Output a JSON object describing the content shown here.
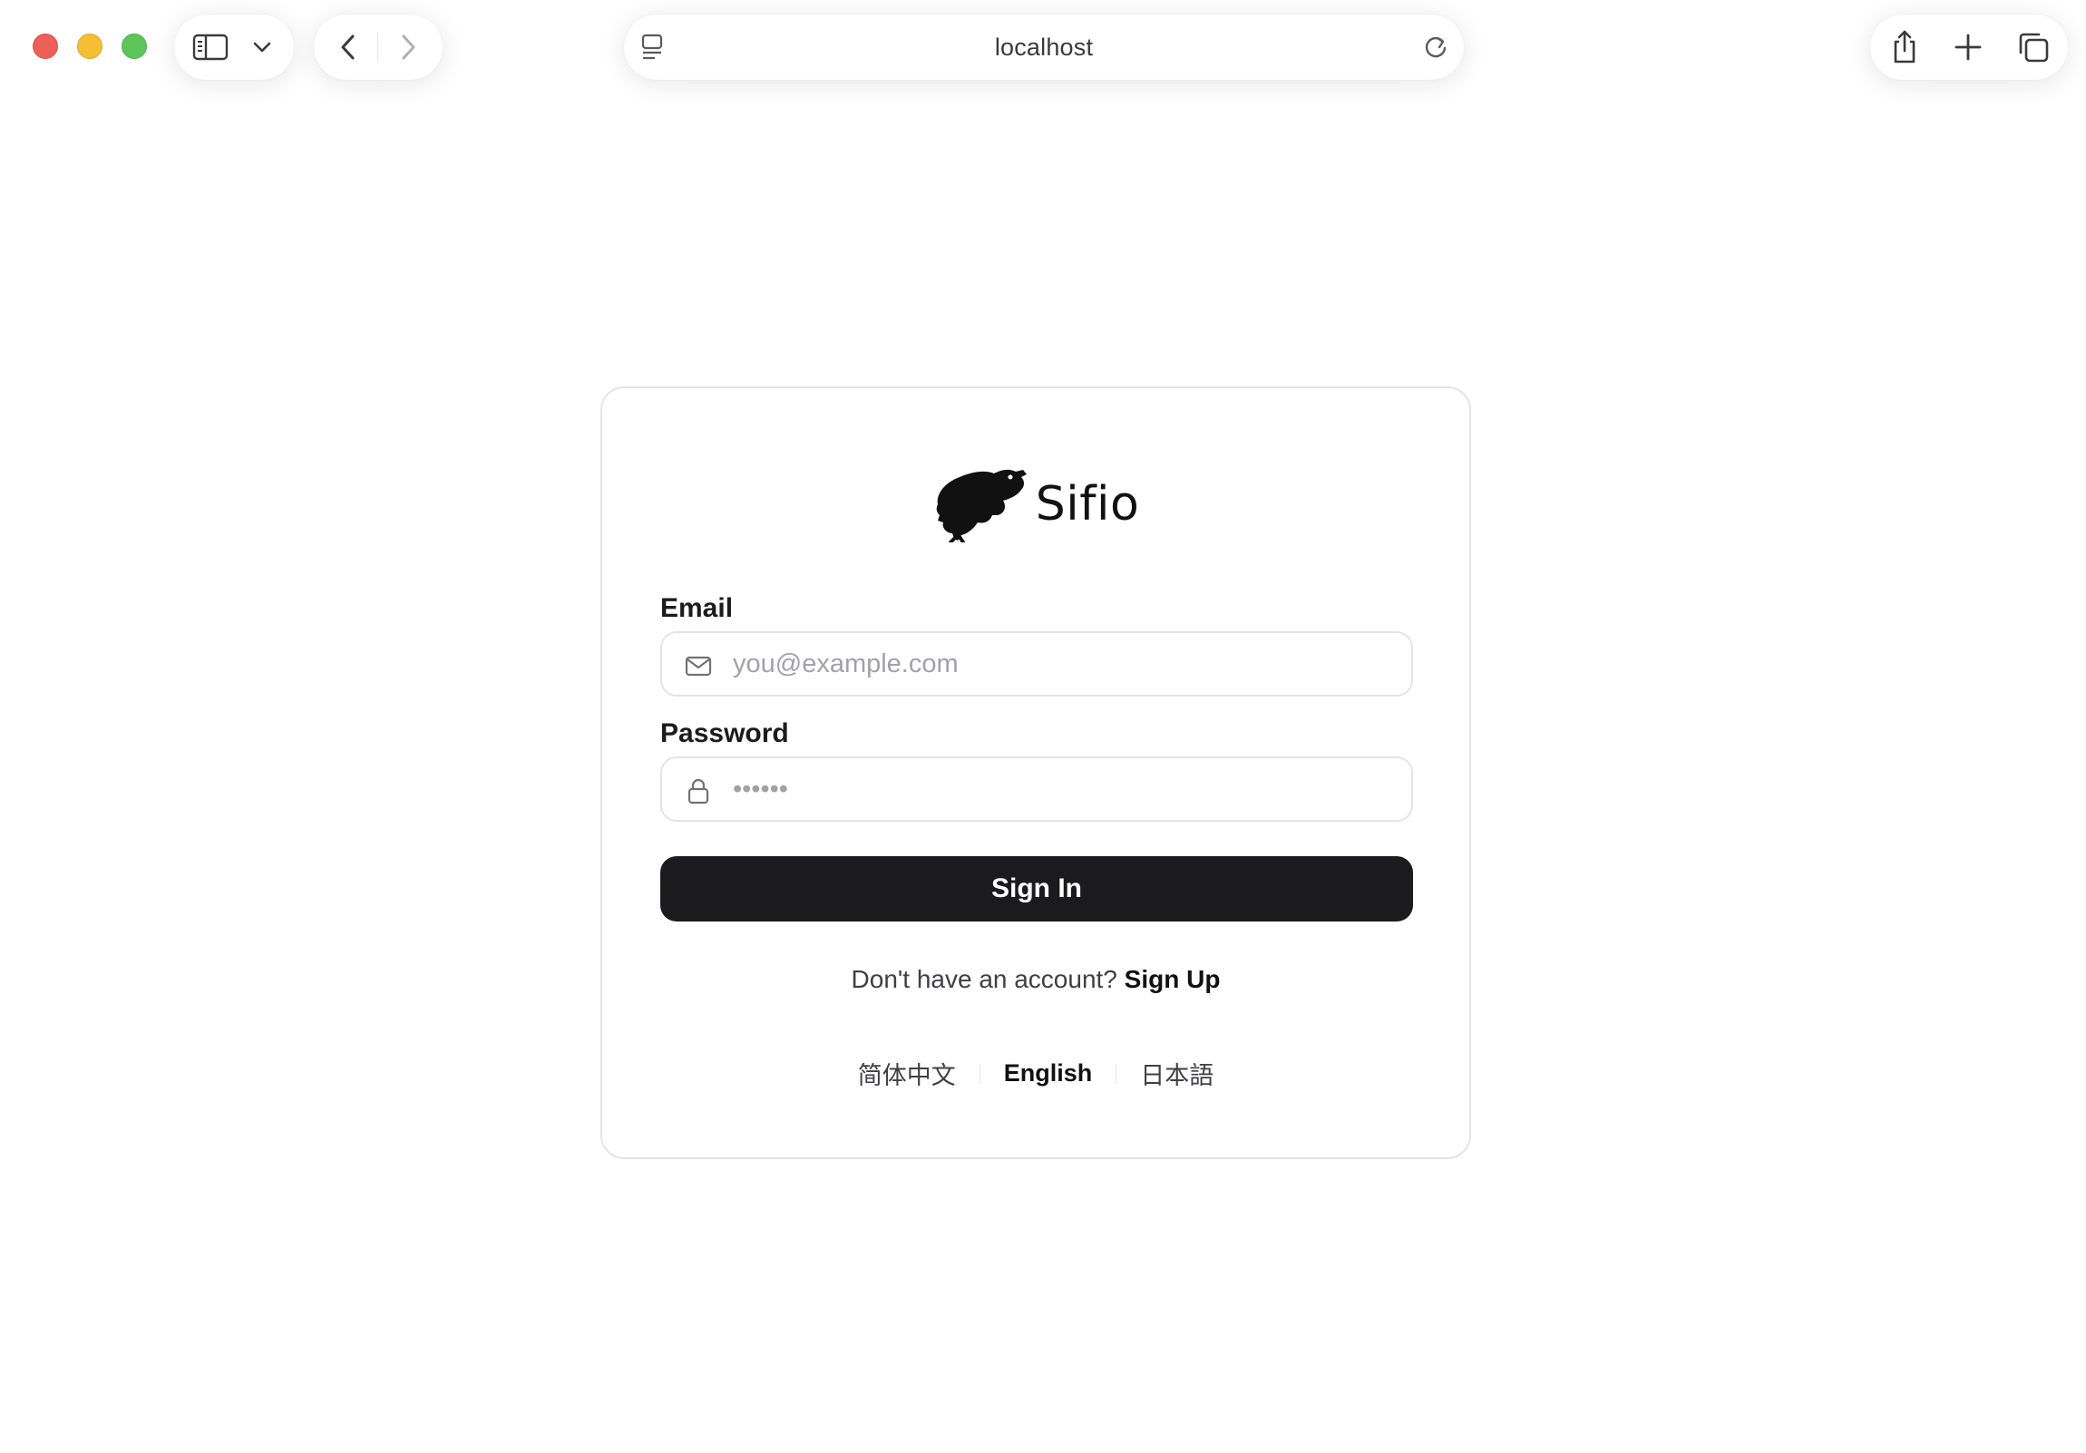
{
  "browser": {
    "url": "localhost",
    "window_controls": [
      "close",
      "minimize",
      "maximize"
    ],
    "icons": {
      "sidebar": "sidebar-icon",
      "sidebar_menu": "chevron-down-icon",
      "back": "chevron-left-icon",
      "forward": "chevron-right-icon",
      "page_menu": "page-menu-icon",
      "reload": "reload-icon",
      "share": "share-icon",
      "new_tab": "plus-icon",
      "tab_overview": "tabs-overview-icon"
    }
  },
  "login": {
    "brand_name": "Sifio",
    "brand_icon": "frog-logo-icon",
    "email": {
      "label": "Email",
      "placeholder": "you@example.com",
      "value": "",
      "icon": "mail-icon"
    },
    "password": {
      "label": "Password",
      "placeholder": "••••••",
      "value": "",
      "icon": "lock-icon"
    },
    "submit_label": "Sign In",
    "signup_prompt": "Don't have an account?",
    "signup_link": "Sign Up",
    "languages": [
      {
        "label": "简体中文",
        "active": false
      },
      {
        "label": "English",
        "active": true
      },
      {
        "label": "日本語",
        "active": false
      }
    ]
  },
  "colors": {
    "primary_button": "#1b1b1d",
    "border": "#e4e4e7",
    "placeholder": "#a1a1aa"
  }
}
